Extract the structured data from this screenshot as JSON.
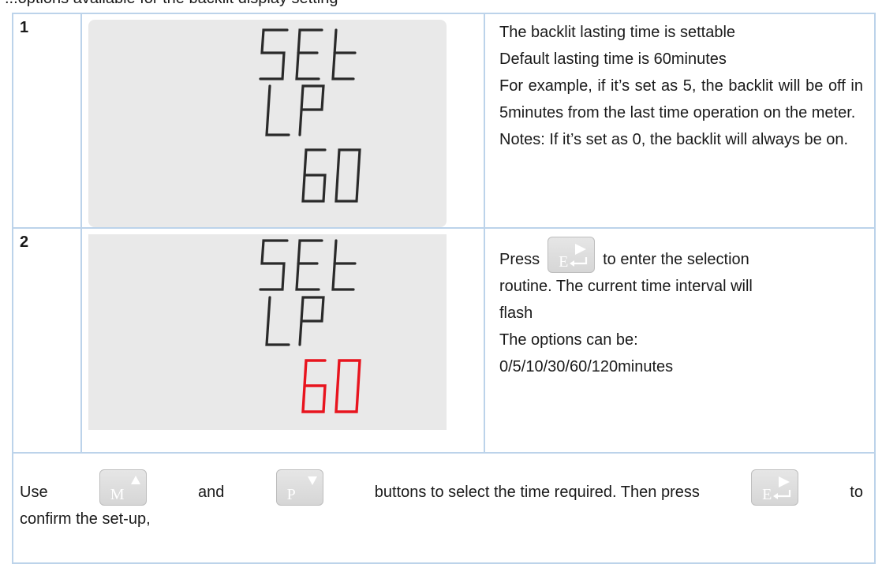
{
  "page_top_fragment": "...options available for the backlit display setting",
  "rows": [
    {
      "number": "1",
      "display": {
        "line1": "SEt",
        "line2": "LP",
        "line3": "60",
        "line3_color": "#222222"
      },
      "paragraphs": [
        "The backlit lasting time is settable",
        "Default lasting time is 60minutes",
        "For example, if it’s set as 5, the backlit will be off in 5minutes from the last time operation on the meter.",
        "Notes: If it’s set as 0, the backlit will always be on."
      ]
    },
    {
      "number": "2",
      "display": {
        "line1": "SEt",
        "line2": "LP",
        "line3": "60",
        "line3_color": "#e8141e"
      },
      "press_before": "Press",
      "press_after": "to enter the selection routine. The current time interval will flash",
      "options_label": "The options can be:",
      "options_values": "0/5/10/30/60/120minutes"
    }
  ],
  "buttons": {
    "enter": {
      "letter": "E",
      "icon": "enter-arrow-icon"
    },
    "up": {
      "letter": "M",
      "icon": "up-triangle-icon"
    },
    "down": {
      "letter": "P",
      "icon": "down-triangle-icon"
    }
  },
  "footer": {
    "use": "Use",
    "and": "and",
    "select": "buttons to select the time required. Then press",
    "to": "to",
    "line2": "confirm the set-up,"
  },
  "colors": {
    "border": "#bcd3ea",
    "lcd_bg": "#e9e9e9",
    "flash": "#e8141e"
  }
}
